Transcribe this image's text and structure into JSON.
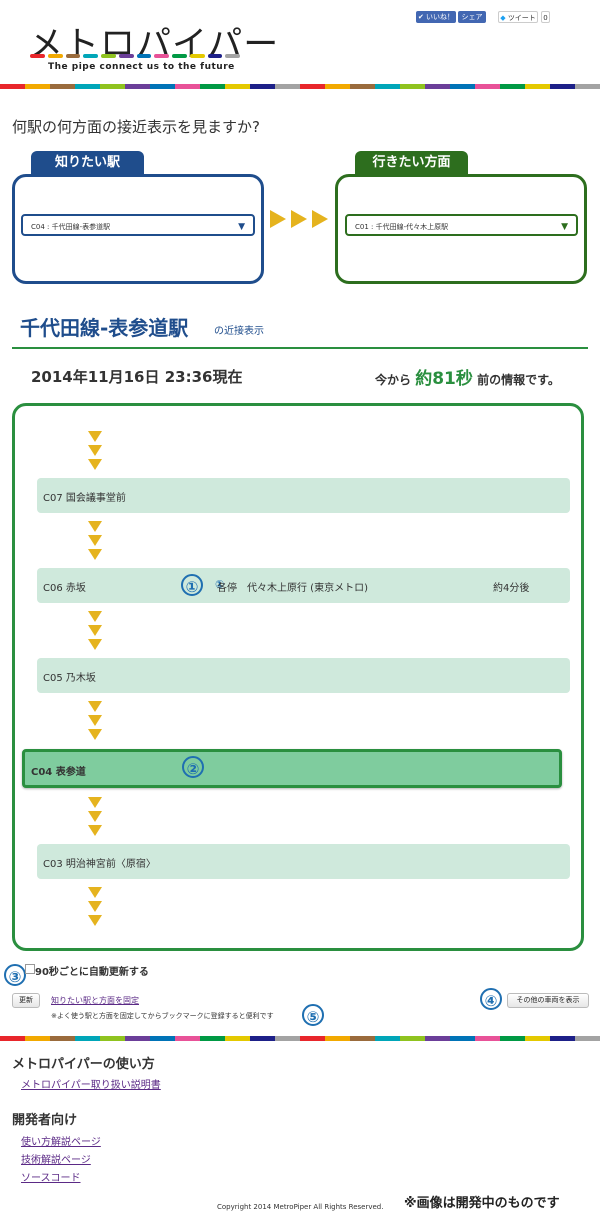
{
  "header": {
    "logo_title": "メトロパイパー",
    "logo_tagline": "The pipe connect us to the future",
    "like_label": "いいね！",
    "share_label": "シェア",
    "tweet_label": "ツイート",
    "tweet_count": "0",
    "brand_colors": [
      "#e8262b",
      "#f2a900",
      "#9a6b3c",
      "#00a6b8",
      "#8fc31f",
      "#6b3e99",
      "#0073b7",
      "#e85298",
      "#009944",
      "#e4c900",
      "#1d2088",
      "#a3a3a3"
    ]
  },
  "question": "何駅の何方面の接近表示を見ますか?",
  "from": {
    "tab_label": "知りたい駅",
    "selected": "C04 : 千代田線-表参道駅",
    "color": "#1f4d8c"
  },
  "to": {
    "tab_label": "行きたい方面",
    "selected": "C01 : 千代田線-代々木上原駅",
    "color": "#2d6e1e"
  },
  "station": {
    "title": "千代田線-表参道駅",
    "suffix": "の近接表示"
  },
  "status": {
    "datetime": "2014年11月16日 23:36現在",
    "info_prefix": "今から",
    "info_value": "約81秒",
    "info_suffix": "前の情報です。"
  },
  "stations": [
    {
      "label": "C07 国会議事堂前"
    },
    {
      "label": "C06 赤坂",
      "marker": "①",
      "train": "各停　代々木上原行 (東京メトロ)",
      "eta": "約4分後"
    },
    {
      "label": "C05 乃木坂"
    },
    {
      "label": "C04 表参道",
      "marker": "②"
    },
    {
      "label": "C03 明治神宮前〈原宿〉"
    }
  ],
  "controls": {
    "auto_refresh_label": "90秒ごとに自動更新する",
    "refresh_button": "更新",
    "fix_link": "知りたい駅と方面を固定",
    "fix_note": "※よく使う駅と方面を固定してからブックマークに登録すると便利です",
    "other_cars_button": "その他の車両を表示",
    "markers": {
      "auto": "③",
      "other": "④",
      "fix": "⑤"
    }
  },
  "footer": {
    "usage_heading": "メトロパイパーの使い方",
    "usage_link": "メトロパイパー取り扱い説明書",
    "dev_heading": "開発者向け",
    "dev_links": [
      "使い方解説ページ",
      "技術解説ページ",
      "ソースコード"
    ],
    "copyright": "Copyright 2014 MetroPiper All Rights Reserved.",
    "notice": "※画像は開発中のものです"
  }
}
